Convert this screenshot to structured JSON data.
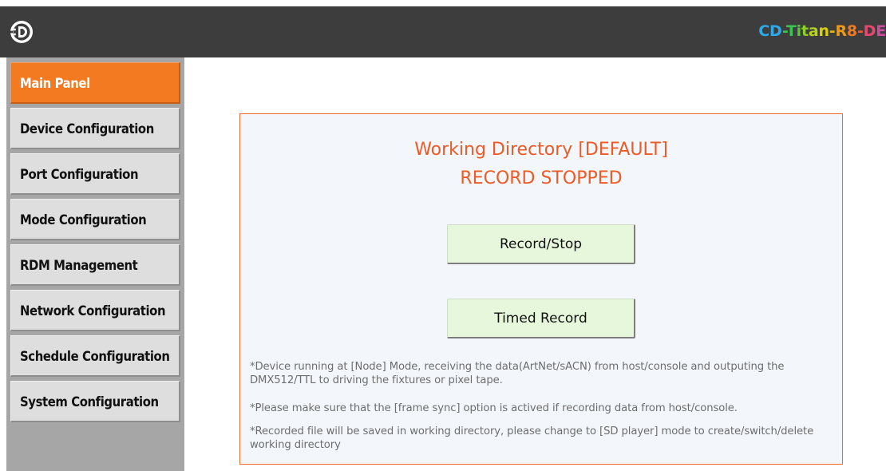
{
  "header": {
    "logo_icon": "cd-logo-icon",
    "device_name_parts": [
      {
        "text": "CD",
        "color": "#2fa8e8"
      },
      {
        "text": "-",
        "color": "#3cc450"
      },
      {
        "text": "T",
        "color": "#3cc450"
      },
      {
        "text": "i",
        "color": "#58c838"
      },
      {
        "text": "t",
        "color": "#8fd028"
      },
      {
        "text": "a",
        "color": "#b7d21c"
      },
      {
        "text": "n",
        "color": "#d8cf16"
      },
      {
        "text": "-",
        "color": "#e8b414"
      },
      {
        "text": "R",
        "color": "#ef9a16"
      },
      {
        "text": "8",
        "color": "#f27a1e"
      },
      {
        "text": "-",
        "color": "#f25a3a"
      },
      {
        "text": "D",
        "color": "#e84870"
      },
      {
        "text": "E",
        "color": "#d04aa0"
      }
    ],
    "background": "#3d3d3d"
  },
  "sidebar": {
    "items": [
      {
        "label": "Main Panel",
        "active": true
      },
      {
        "label": "Device Configuration",
        "active": false
      },
      {
        "label": "Port Configuration",
        "active": false
      },
      {
        "label": "Mode Configuration",
        "active": false
      },
      {
        "label": "RDM Management",
        "active": false
      },
      {
        "label": "Network Configuration",
        "active": false
      },
      {
        "label": "Schedule Configuration",
        "active": false
      },
      {
        "label": "System Configuration",
        "active": false
      }
    ],
    "active_color": "#f47a22"
  },
  "main": {
    "status_line1": "Working Directory [DEFAULT]",
    "status_line2": "RECORD STOPPED",
    "status_color": "#ec5a26",
    "record_stop_label": "Record/Stop",
    "timed_record_label": "Timed Record",
    "notes": [
      "*Device running at [Node] Mode, receiving the data(ArtNet/sACN) from host/console and outputing the DMX512/TTL to driving the fixtures or pixel tape.",
      "*Please make sure that the [frame sync] option is actived if recording data from host/console.",
      "*Recorded file will be saved in working directory, please change to [SD player] mode to create/switch/delete working directory"
    ]
  }
}
